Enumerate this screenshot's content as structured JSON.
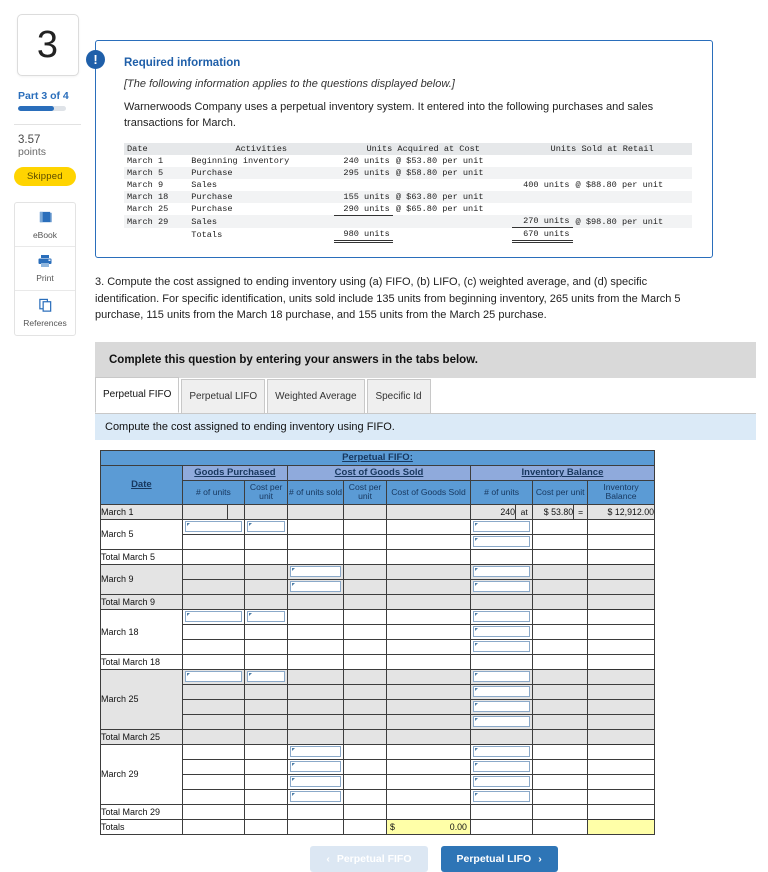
{
  "rail": {
    "question_number": "3",
    "part_label": "Part 3 of 4",
    "progress_percent": 75,
    "points_value": "3.57",
    "points_unit": "points",
    "status_badge": "Skipped",
    "tools": [
      {
        "label": "eBook",
        "icon": "book-icon"
      },
      {
        "label": "Print",
        "icon": "printer-icon"
      },
      {
        "label": "References",
        "icon": "copy-pages-icon"
      }
    ]
  },
  "required_info": {
    "icon": "exclamation-icon",
    "title": "Required information",
    "applies_note": "[The following information applies to the questions displayed below.]",
    "body": "Warnerwoods Company uses a perpetual inventory system. It entered into the following purchases and sales transactions for March.",
    "table": {
      "headers": [
        "Date",
        "Activities",
        "Units Acquired at Cost",
        "Units Sold at Retail"
      ],
      "rows": [
        {
          "date": "March 1",
          "activity": "Beginning inventory",
          "acq_units": "240 units",
          "acq_cost": "@ $53.80 per unit",
          "sold_units": "",
          "sold_price": ""
        },
        {
          "date": "March 5",
          "activity": "Purchase",
          "acq_units": "295 units",
          "acq_cost": "@ $58.80 per unit",
          "sold_units": "",
          "sold_price": ""
        },
        {
          "date": "March 9",
          "activity": "Sales",
          "acq_units": "",
          "acq_cost": "",
          "sold_units": "400 units",
          "sold_price": "@ $88.80 per unit"
        },
        {
          "date": "March 18",
          "activity": "Purchase",
          "acq_units": "155 units",
          "acq_cost": "@ $63.80 per unit",
          "sold_units": "",
          "sold_price": ""
        },
        {
          "date": "March 25",
          "activity": "Purchase",
          "acq_units": "290 units",
          "acq_cost": "@ $65.80 per unit",
          "sold_units": "",
          "sold_price": ""
        },
        {
          "date": "March 29",
          "activity": "Sales",
          "acq_units": "",
          "acq_cost": "",
          "sold_units": "270 units",
          "sold_price": "@ $98.80 per unit"
        }
      ],
      "totals": {
        "label": "Totals",
        "acquired": "980 units",
        "sold": "670 units"
      }
    }
  },
  "question": {
    "text": "3. Compute the cost assigned to ending inventory using (a) FIFO, (b) LIFO, (c) weighted average, and (d) specific identification. For specific identification, units sold include 135 units from beginning inventory, 265 units from the March 5 purchase, 115 units from the March 18 purchase, and 155 units from the March 25 purchase."
  },
  "complete_bar": "Complete this question by entering your answers in the tabs below.",
  "tabs": [
    {
      "label": "Perpetual FIFO",
      "active": true
    },
    {
      "label": "Perpetual LIFO",
      "active": false
    },
    {
      "label": "Weighted Average",
      "active": false
    },
    {
      "label": "Specific Id",
      "active": false
    }
  ],
  "tab_instruction": "Compute the cost assigned to ending inventory using FIFO.",
  "sheet": {
    "title": "Perpetual FIFO:",
    "group_headers": [
      "Goods Purchased",
      "Cost of Goods Sold",
      "Inventory Balance"
    ],
    "date_header": "Date",
    "col_headers": {
      "gp_units": "# of units",
      "gp_cost": "Cost per unit",
      "cogs_units": "# of units sold",
      "cogs_cost": "Cost per unit",
      "cogs_total": "Cost of Goods Sold",
      "inv_units": "# of units",
      "inv_cost": "Cost per unit",
      "inv_balance": "Inventory Balance"
    },
    "opening_row": {
      "label": "March 1",
      "inv_units": "240",
      "at": "at",
      "inv_cost": "$ 53.80",
      "eq": "=",
      "inv_balance": "$ 12,912.00"
    },
    "row_labels": {
      "m5": "March 5",
      "t5": "Total March 5",
      "m9": "March 9",
      "t9": "Total March 9",
      "m18": "March 18",
      "t18": "Total March 18",
      "m25": "March 25",
      "t25": "Total March 25",
      "m29": "March 29",
      "t29": "Total March 29",
      "totals": "Totals"
    },
    "totals_row": {
      "currency": "$",
      "value": "0.00"
    }
  },
  "nav": {
    "prev_label": "Perpetual FIFO",
    "prev_icon": "chevron-left-icon",
    "next_label": "Perpetual LIFO",
    "next_icon": "chevron-right-icon"
  },
  "colors": {
    "accent_blue": "#2a6ebb",
    "header_blue": "#5b9bd5",
    "group_blue": "#8faadc",
    "badge_yellow": "#ffd400",
    "input_yellow": "#ffffa8"
  }
}
